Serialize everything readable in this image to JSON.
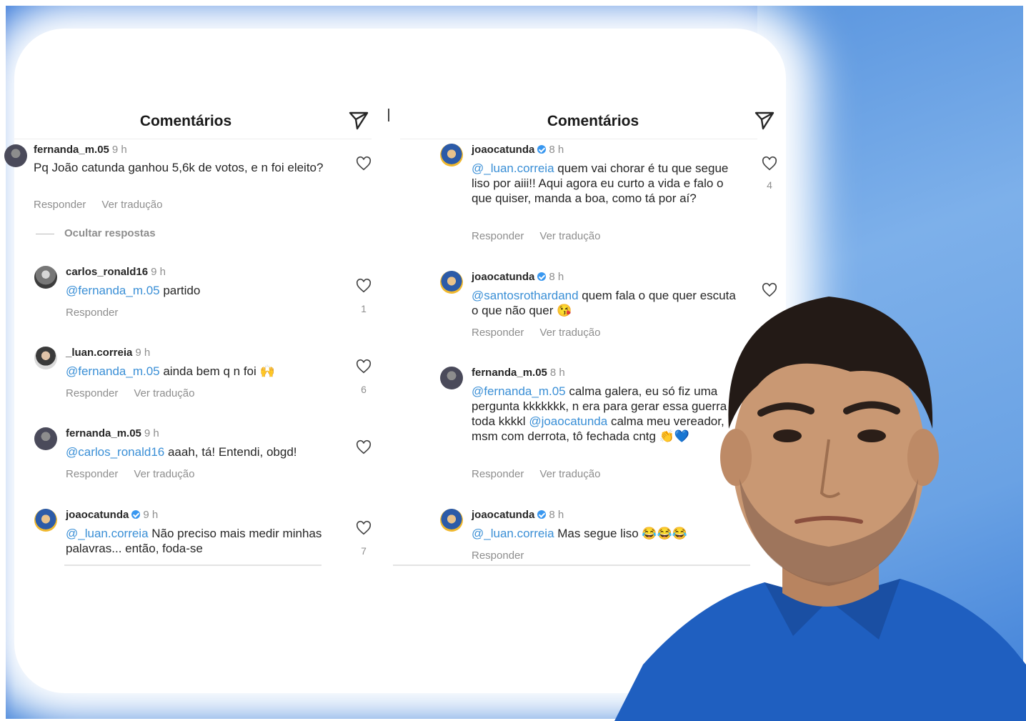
{
  "left_panel": {
    "title": "Comentários",
    "hide_replies": "Ocultar respostas",
    "comments": [
      {
        "user": "fernanda_m.05",
        "time": "9 h",
        "text": "Pq João catunda ganhou 5,6k de votos, e n foi eleito?",
        "reply": "Responder",
        "translate": "Ver tradução",
        "likes": ""
      },
      {
        "user": "carlos_ronald16",
        "time": "9 h",
        "mention": "@fernanda_m.05",
        "text": " partido",
        "reply": "Responder",
        "likes": "1"
      },
      {
        "user": "_luan.correia",
        "time": "9 h",
        "mention": "@fernanda_m.05",
        "text": " ainda bem q n foi ",
        "emoji": "🙌",
        "reply": "Responder",
        "translate": "Ver tradução",
        "likes": "6"
      },
      {
        "user": "fernanda_m.05",
        "time": "9 h",
        "mention": "@carlos_ronald16",
        "text": " aaah, tá! Entendi, obgd!",
        "reply": "Responder",
        "translate": "Ver tradução",
        "likes": ""
      },
      {
        "user": "joaocatunda",
        "time": "9 h",
        "mention": "@_luan.correia",
        "text": " Não preciso mais medir minhas palavras... então, foda-se",
        "likes": "7"
      }
    ]
  },
  "right_panel": {
    "title": "Comentários",
    "comments": [
      {
        "user": "joaocatunda",
        "time": "8 h",
        "mention": "@_luan.correia",
        "text": " quem vai chorar é tu que segue liso por aiii!! Aqui agora eu curto a vida e falo o que quiser, manda a boa, como tá por aí?",
        "reply": "Responder",
        "translate": "Ver tradução",
        "likes": "4"
      },
      {
        "user": "joaocatunda",
        "time": "8 h",
        "mention": "@santosrothardand",
        "text": " quem fala o que quer escuta o que não quer ",
        "emoji": "😘",
        "reply": "Responder",
        "translate": "Ver tradução"
      },
      {
        "user": "fernanda_m.05",
        "time": "8 h",
        "mention": "@fernanda_m.05",
        "text_a": " calma galera, eu só fiz uma pergunta kkkkkkk, n era para gerar essa guerra toda kkkkl ",
        "mention2": "@joaocatunda",
        "text_b": " calma meu vereador, msm com derrota, tô fechada cntg ",
        "emoji": "👏💙",
        "reply": "Responder",
        "translate": "Ver tradução"
      },
      {
        "user": "joaocatunda",
        "time": "8 h",
        "mention": "@_luan.correia",
        "text": " Mas segue liso ",
        "emoji": "😂😂😂",
        "reply": "Responder",
        "likes": "1"
      }
    ]
  },
  "colors": {
    "mention": "#3a8fd6",
    "verified": "#3897f0",
    "background_blue": "#4a8ae0",
    "shirt": "#1f5fc0"
  },
  "icons": [
    "share-icon",
    "heart-icon",
    "verified-icon",
    "avatar"
  ]
}
